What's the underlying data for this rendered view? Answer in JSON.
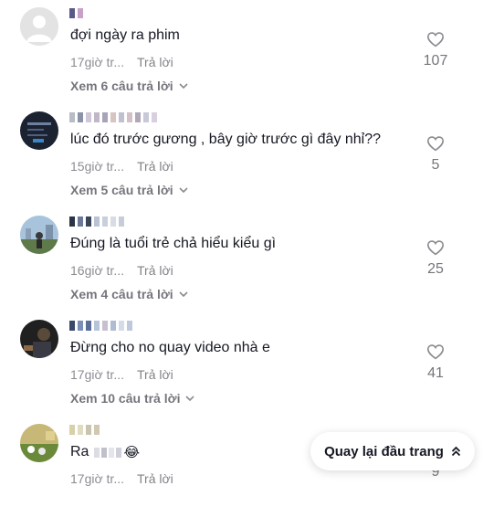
{
  "comments": [
    {
      "text": "đợi ngày ra phim",
      "time": "17giờ tr...",
      "reply": "Trả lời",
      "likes": "107",
      "view_replies": "Xem 6 câu trả lời",
      "avatar": "default"
    },
    {
      "text": "lúc đó trước gương , bây giờ trước gì đây nhỉ??",
      "time": "15giờ tr...",
      "reply": "Trả lời",
      "likes": "5",
      "view_replies": "Xem 5 câu trả lời",
      "avatar": "photo"
    },
    {
      "text": "Đúng là tuổi trẻ chả hiểu kiểu gì",
      "time": "16giờ tr...",
      "reply": "Trả lời",
      "likes": "25",
      "view_replies": "Xem 4 câu trả lời",
      "avatar": "photo"
    },
    {
      "text": "Đừng cho no quay video nhà e",
      "time": "17giờ tr...",
      "reply": "Trả lời",
      "likes": "41",
      "view_replies": "Xem 10 câu trả lời",
      "avatar": "photo"
    },
    {
      "text": "Ra",
      "emoji": "😂",
      "time": "17giờ tr...",
      "reply": "Trả lời",
      "likes": "9",
      "avatar": "photo"
    }
  ],
  "back_to_top": {
    "label": "Quay lại đầu trang",
    "icon": "double-chevron-up-icon"
  },
  "colors": {
    "text": "#161823",
    "muted": "#8a8b91",
    "heart": "#8a8b91"
  }
}
